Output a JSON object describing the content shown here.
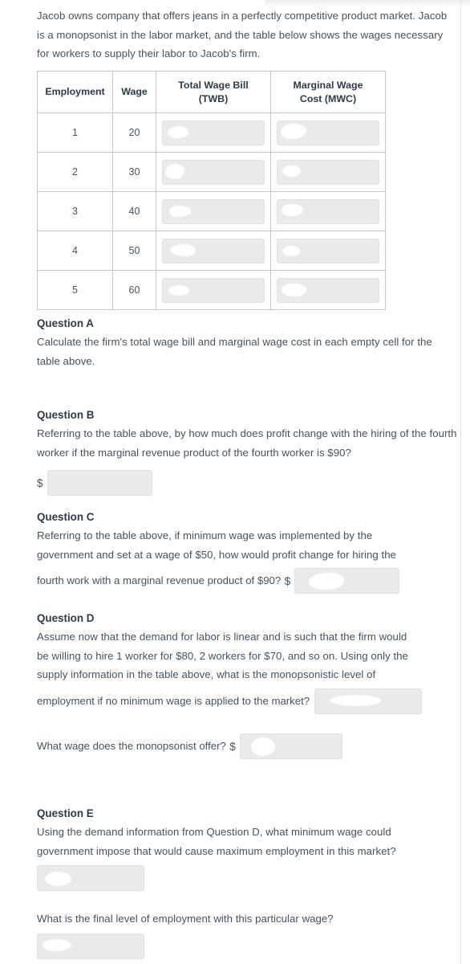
{
  "intro": {
    "paragraph": "Jacob owns company that offers jeans in a perfectly competitive product market. Jacob is a monopsonist in the labor market, and the table below shows the wages necessary for workers to supply their labor to Jacob's firm."
  },
  "table": {
    "headers": {
      "employment": "Employment",
      "wage": "Wage",
      "twb_line1": "Total Wage Bill",
      "twb_line2": "(TWB)",
      "mwc_line1": "Marginal Wage",
      "mwc_line2": "Cost (MWC)"
    },
    "rows": [
      {
        "employment": "1",
        "wage": "20",
        "twb": "",
        "mwc": ""
      },
      {
        "employment": "2",
        "wage": "30",
        "twb": "",
        "mwc": ""
      },
      {
        "employment": "3",
        "wage": "40",
        "twb": "",
        "mwc": ""
      },
      {
        "employment": "4",
        "wage": "50",
        "twb": "",
        "mwc": ""
      },
      {
        "employment": "5",
        "wage": "60",
        "twb": "",
        "mwc": ""
      }
    ]
  },
  "questions": {
    "a": {
      "heading": "Question A",
      "text": "Calculate the firm's total wage bill and marginal wage cost in each empty cell for the table above."
    },
    "b": {
      "heading": "Question B",
      "text": "Referring to the table above, by how much does profit change with the hiring of the fourth worker if the marginal revenue product of the fourth worker is $90?",
      "currency_symbol": "$",
      "answer_value": ""
    },
    "c": {
      "heading": "Question C",
      "text_line1": "Referring to the table above, if minimum wage was implemented by the",
      "text_line2": "government and set at a wage of $50, how would profit change for hiring the",
      "text_line3": "fourth work with a marginal revenue product of $90?",
      "currency_symbol": "$",
      "answer_value": ""
    },
    "d": {
      "heading": "Question D",
      "text_line1": "Assume now that the demand for labor is linear and is such that the firm would",
      "text_line2": "be willing to hire 1 worker for $80, 2 workers for $70, and so on. Using only the",
      "text_line3": "supply information in the table above, what is the monopsonistic level of",
      "text_line4": "employment if no minimum wage is applied to the market?",
      "answer_value": "",
      "follow_up_text": "What wage does the monopsonist offer?",
      "follow_up_currency_symbol": "$",
      "follow_up_answer_value": ""
    },
    "e": {
      "heading": "Question E",
      "text_line1": "Using the demand information from Question D, what minimum wage could",
      "text_line2": "government impose that would cause maximum employment in this market?",
      "answer_value": "",
      "follow_up_text": "What is the final level of employment with this particular wage?",
      "follow_up_answer_value": ""
    }
  }
}
